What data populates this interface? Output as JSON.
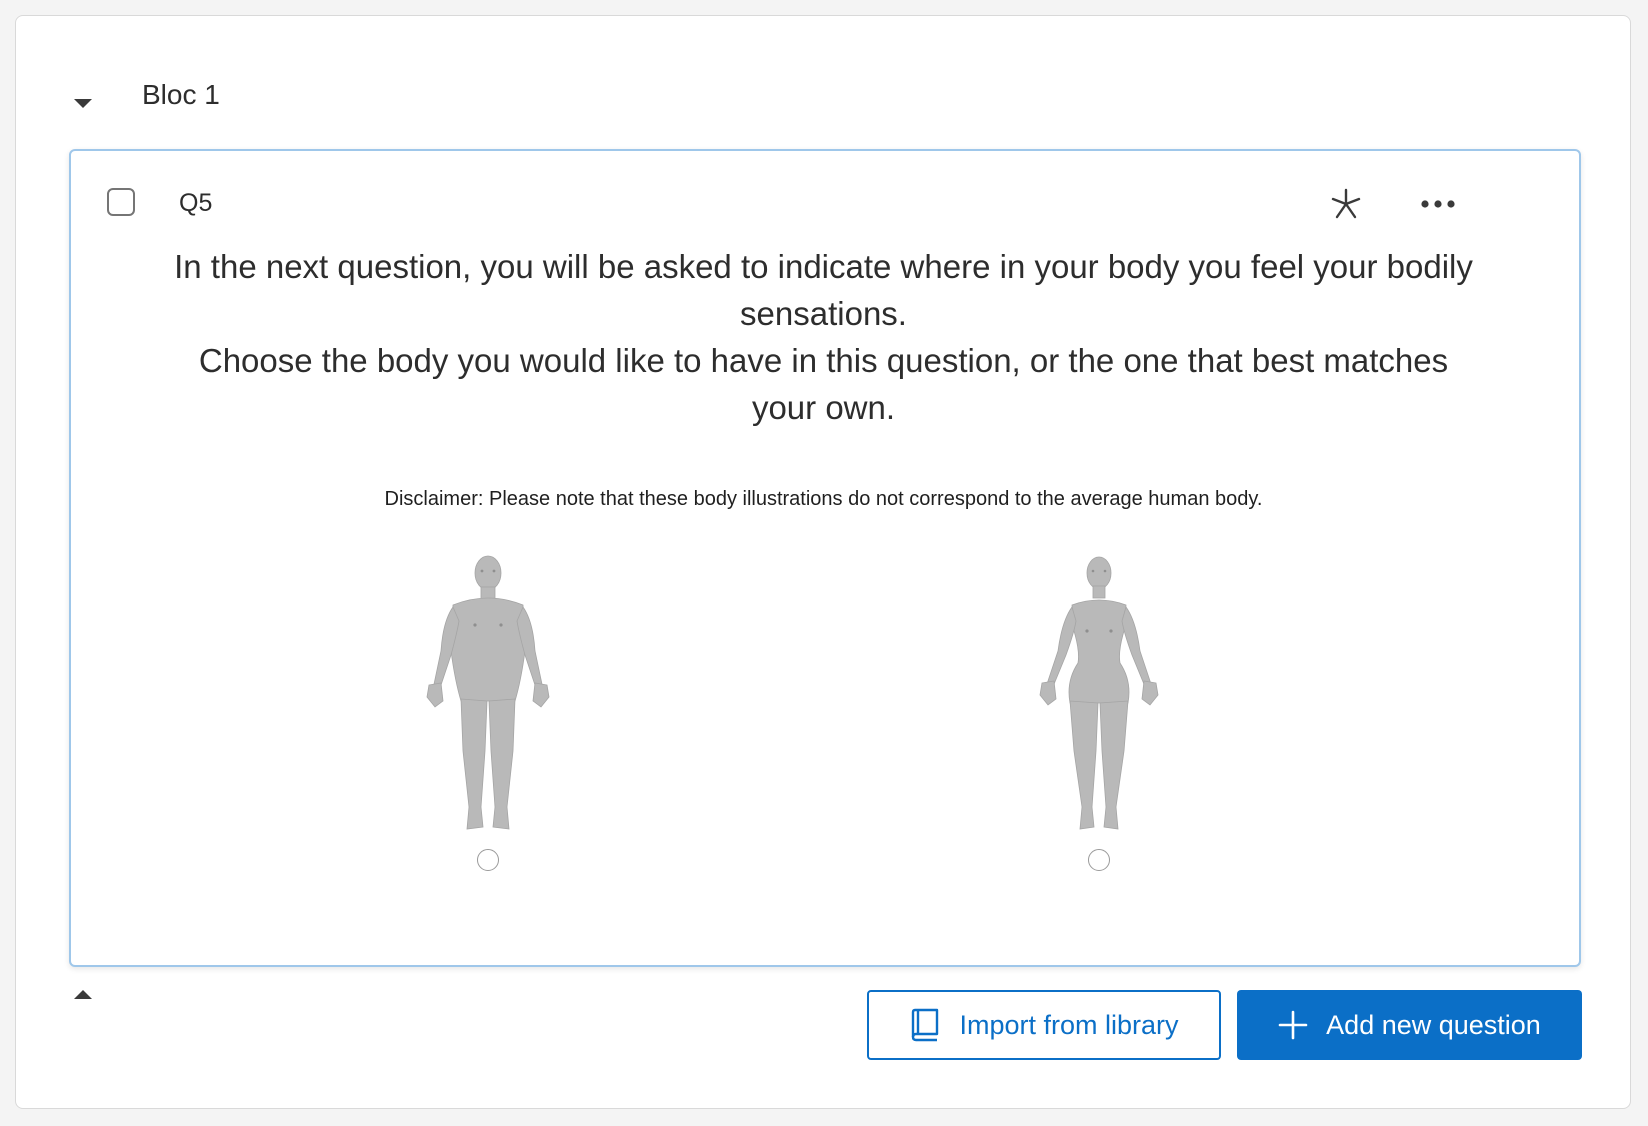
{
  "block": {
    "title": "Bloc 1"
  },
  "question": {
    "id": "Q5",
    "text_lines": [
      "In the next question, you will be asked to indicate where in your body you feel your bodily sensations.",
      "Choose the body you would like to have in this question, or the one that best matches your own."
    ],
    "disclaimer": "Disclaimer: Please note that these body illustrations do not correspond to the average human body.",
    "choices": [
      {
        "name": "male-body",
        "selected": false
      },
      {
        "name": "female-body",
        "selected": false
      }
    ]
  },
  "actions": {
    "import_label": "Import from library",
    "add_label": "Add new question"
  },
  "icons": {
    "collapse": "caret-down-icon",
    "expand": "caret-up-icon",
    "required": "asterisk-icon",
    "more": "ellipsis-icon",
    "import": "book-icon",
    "add": "plus-icon"
  },
  "colors": {
    "accent": "#0b6fc7",
    "card_border": "#9fc7ea",
    "body_fill": "#b9b9b9"
  }
}
